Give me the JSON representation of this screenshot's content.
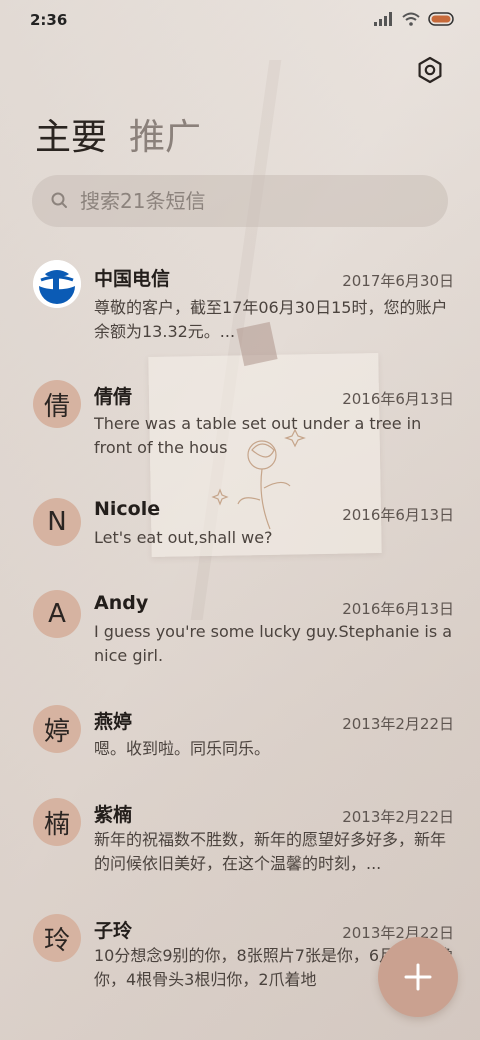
{
  "status": {
    "time": "2:36"
  },
  "tabs": {
    "main": "主要",
    "promo": "推广"
  },
  "search": {
    "placeholder": "搜索21条短信"
  },
  "messages": [
    {
      "avatar": "",
      "name": "中国电信",
      "date": "2017年6月30日",
      "preview": "尊敬的客户，截至17年06月30日15时，您的账户余额为13.32元。..."
    },
    {
      "avatar": "倩",
      "name": "倩倩",
      "date": "2016年6月13日",
      "preview": "There was a table set out under a tree in front of the hous"
    },
    {
      "avatar": "N",
      "name": "Nicole",
      "date": "2016年6月13日",
      "preview": "Let's eat out,shall we?"
    },
    {
      "avatar": "A",
      "name": "Andy",
      "date": "2016年6月13日",
      "preview": "I guess you're some lucky guy.Stephanie is a nice girl."
    },
    {
      "avatar": "婷",
      "name": "燕婷",
      "date": "2013年2月22日",
      "preview": "嗯。收到啦。同乐同乐。"
    },
    {
      "avatar": "楠",
      "name": "紫楠",
      "date": "2013年2月22日",
      "preview": "新年的祝福数不胜数，新年的愿望好多好多，新年的问候依旧美好，在这个温馨的时刻，..."
    },
    {
      "avatar": "玲",
      "name": "子玲",
      "date": "2013年2月22日",
      "preview": "10分想念9别的你，8张照片7张是你，6月天5只像你，4根骨头3根归你，2爪着地"
    }
  ],
  "colors": {
    "avatar_bg": "#d6b3a1",
    "fab_bg": "#caa190",
    "telecom_blue": "#0b5bb5"
  }
}
